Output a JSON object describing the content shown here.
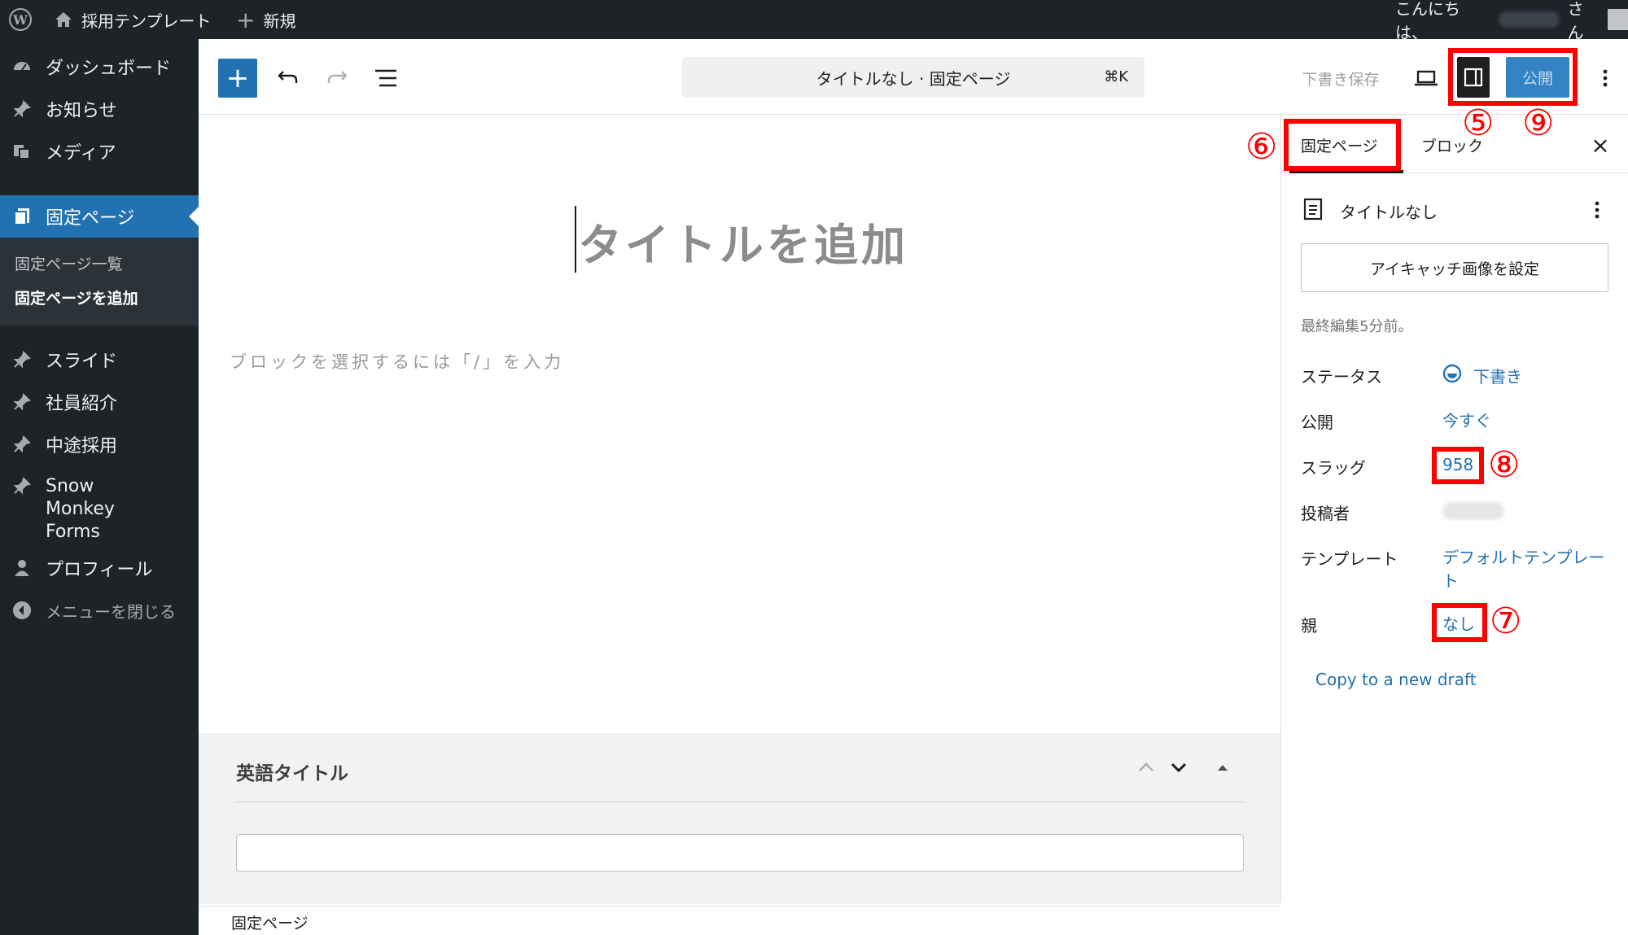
{
  "adminbar": {
    "site_name": "採用テンプレート",
    "new_label": "新規",
    "greeting": "こんにちは、",
    "greeting_suffix": "さん"
  },
  "sidebar": {
    "dashboard": "ダッシュボード",
    "items": [
      {
        "label": "お知らせ",
        "icon": "pin-icon"
      },
      {
        "label": "メディア",
        "icon": "media-icon"
      },
      {
        "label": "固定ページ",
        "icon": "pages-icon"
      },
      {
        "label": "スライド",
        "icon": "pin-icon"
      },
      {
        "label": "社員紹介",
        "icon": "pin-icon"
      },
      {
        "label": "中途採用",
        "icon": "pin-icon"
      },
      {
        "label": "Snow Monkey Forms",
        "icon": "pin-icon"
      },
      {
        "label": "プロフィール",
        "icon": "user-icon"
      }
    ],
    "submenu": [
      "固定ページ一覧",
      "固定ページを追加"
    ],
    "collapse": "メニューを閉じる"
  },
  "header": {
    "doc_title": "タイトルなし · 固定ページ",
    "shortcut": "⌘K",
    "save_draft": "下書き保存",
    "publish": "公開"
  },
  "editor": {
    "title_placeholder": "タイトルを追加",
    "block_prompt": "ブロックを選択するには「/」を入力",
    "meta_box_title": "英語タイトル",
    "footer_breadcrumb": "固定ページ"
  },
  "settings": {
    "tabs": [
      "固定ページ",
      "ブロック"
    ],
    "summary_title": "タイトルなし",
    "featured_image": "アイキャッチ画像を設定",
    "last_edited": "最終編集5分前。",
    "rows": [
      {
        "label": "ステータス",
        "value": "下書き"
      },
      {
        "label": "公開",
        "value": "今すぐ"
      },
      {
        "label": "スラッグ",
        "value": "958"
      },
      {
        "label": "投稿者",
        "value": ""
      },
      {
        "label": "テンプレート",
        "value": "デフォルトテンプレート"
      },
      {
        "label": "親",
        "value": "なし"
      }
    ],
    "copy_draft": "Copy to a new draft"
  },
  "annotations": [
    "⑤",
    "⑥",
    "⑦",
    "⑧",
    "⑨"
  ],
  "colors": {
    "accent": "#3582c4",
    "annotation": "#ff0000",
    "admin_dark": "#1d2327",
    "link": "#2271b1"
  }
}
